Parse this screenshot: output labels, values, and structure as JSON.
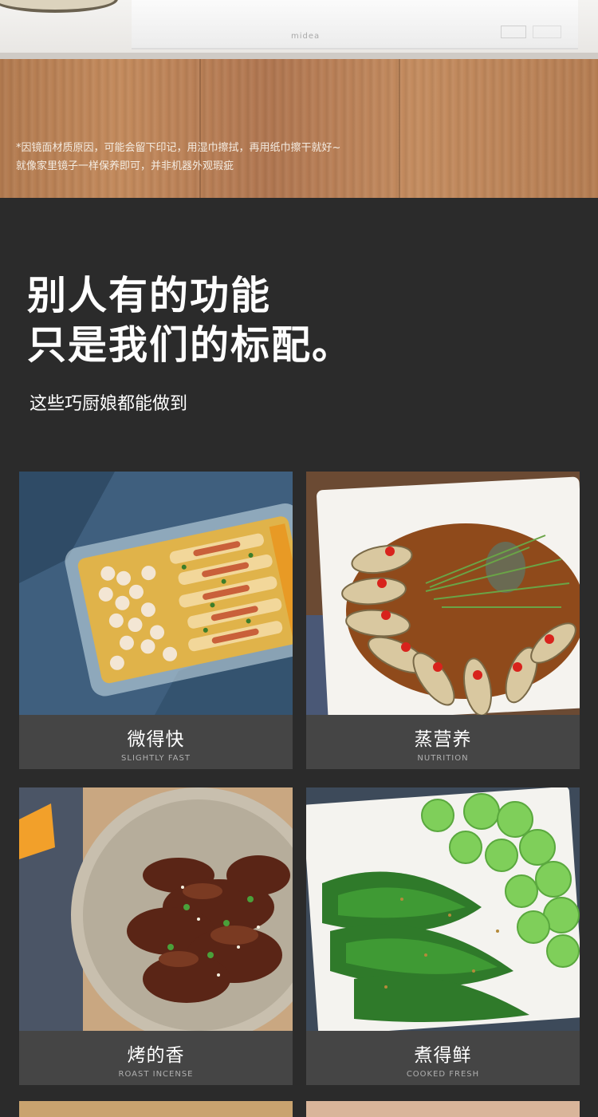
{
  "top_photo": {
    "brand_mark": "midea",
    "note_lines": [
      "*因镜面材质原因，可能会留下印记，用湿巾擦拭，再用纸巾擦干就好~",
      "  就像家里镜子一样保养即可，并非机器外观瑕疵"
    ]
  },
  "intro": {
    "headline_lines": [
      "别人有的功能",
      "只是我们的标配。"
    ],
    "subhead": "这些巧厨娘都能做到"
  },
  "features": [
    {
      "title": "微得快",
      "subtitle": "SLIGHTLY FAST",
      "photo_icon": "steamed-shrimp-tofu-dish-icon"
    },
    {
      "title": "蒸营养",
      "subtitle": "NUTRITION",
      "photo_icon": "steamed-fish-dish-icon"
    },
    {
      "title": "烤的香",
      "subtitle": "ROAST INCENSE",
      "photo_icon": "roasted-beef-dish-icon"
    },
    {
      "title": "煮得鲜",
      "subtitle": "COOKED FRESH",
      "photo_icon": "boiled-greens-dish-icon"
    }
  ],
  "colors": {
    "background_dark": "#2b2b2b",
    "caption_bg": "#454545",
    "wood": "#b87f54",
    "text_white": "#ffffff"
  }
}
